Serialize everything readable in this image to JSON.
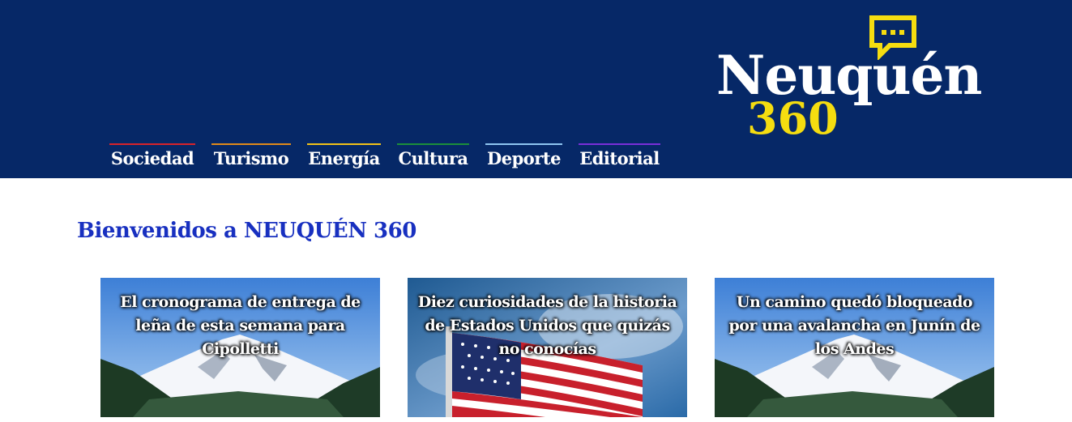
{
  "brand": {
    "name": "Neuquén",
    "number": "360"
  },
  "nav": [
    {
      "label": "Sociedad",
      "color": "#d8232a"
    },
    {
      "label": "Turismo",
      "color": "#e08a1a"
    },
    {
      "label": "Energía",
      "color": "#f2c218"
    },
    {
      "label": "Cultura",
      "color": "#1c8f3a"
    },
    {
      "label": "Deporte",
      "color": "#8ec5f0"
    },
    {
      "label": "Editorial",
      "color": "#7a2fd8"
    }
  ],
  "welcome": "Bienvenidos a NEUQUÉN 360",
  "articles": [
    {
      "title": "El cronograma de entrega de leña de esta semana para Cipolletti",
      "image": "volcano-landscape"
    },
    {
      "title": "Diez curiosidades de la historia de Estados Unidos que quizás no conocías",
      "image": "us-flag"
    },
    {
      "title": "Un camino quedó bloqueado por una avalancha en Junín de los Andes",
      "image": "volcano-landscape"
    }
  ],
  "colors": {
    "header_bg": "#062867",
    "logo_accent": "#f5dd10",
    "welcome_text": "#1830c0"
  }
}
